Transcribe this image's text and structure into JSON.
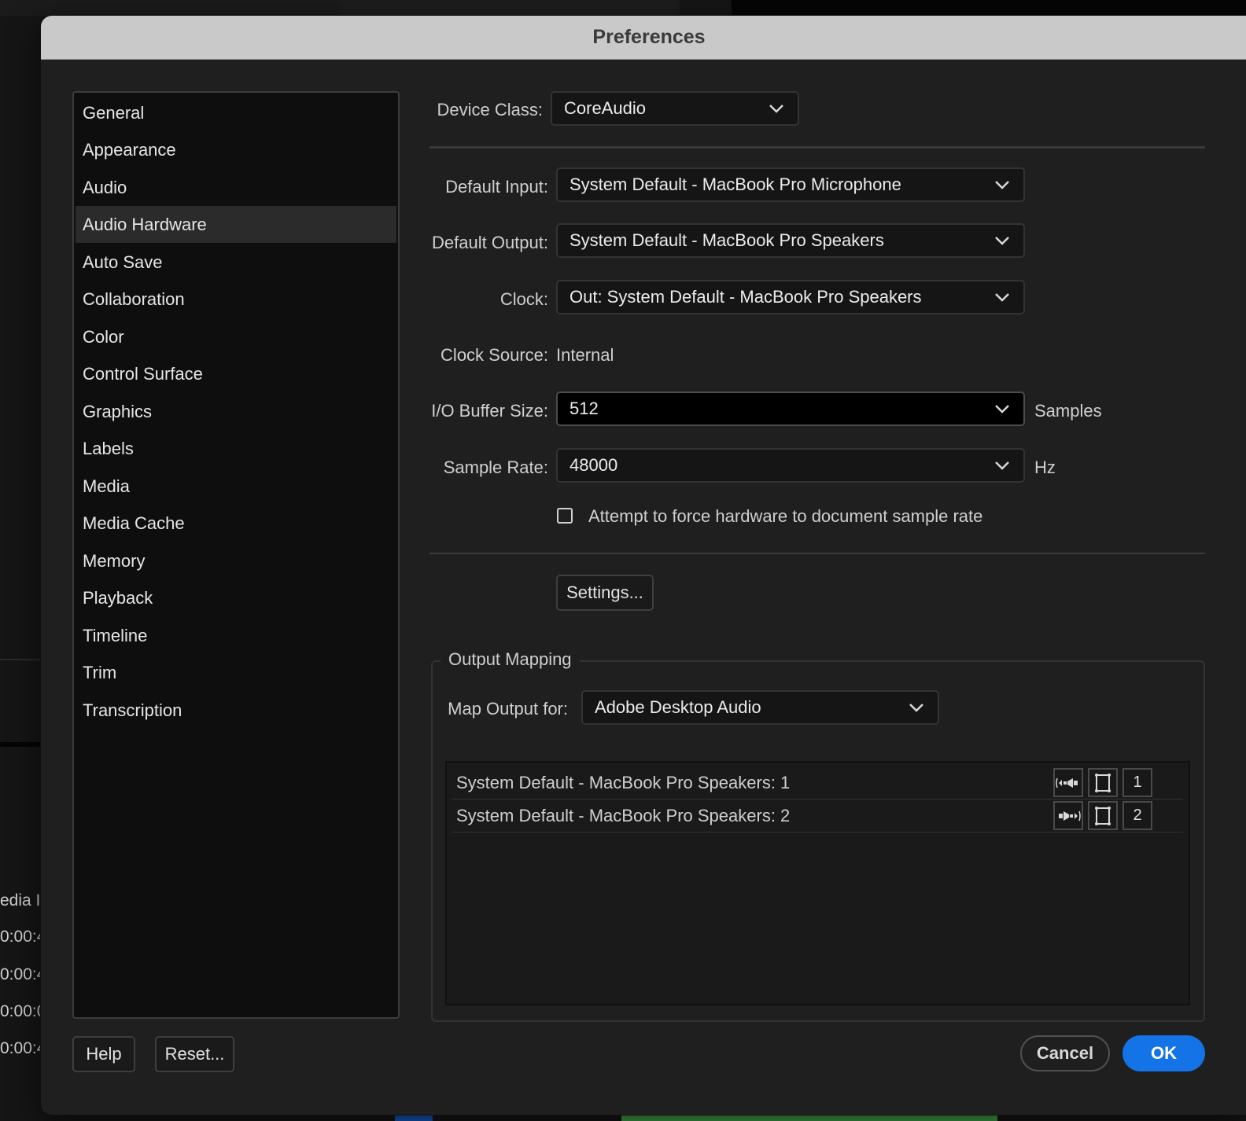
{
  "background": {
    "timecodes": [
      "edia I",
      "0:00:4",
      "0:00:4",
      "0:00:0",
      "0:00:4"
    ]
  },
  "dialog": {
    "title": "Preferences"
  },
  "nav": {
    "items": [
      {
        "label": "General"
      },
      {
        "label": "Appearance"
      },
      {
        "label": "Audio"
      },
      {
        "label": "Audio Hardware",
        "selected": true
      },
      {
        "label": "Auto Save"
      },
      {
        "label": "Collaboration"
      },
      {
        "label": "Color"
      },
      {
        "label": "Control Surface"
      },
      {
        "label": "Graphics"
      },
      {
        "label": "Labels"
      },
      {
        "label": "Media"
      },
      {
        "label": "Media Cache"
      },
      {
        "label": "Memory"
      },
      {
        "label": "Playback"
      },
      {
        "label": "Timeline"
      },
      {
        "label": "Trim"
      },
      {
        "label": "Transcription"
      }
    ]
  },
  "device_class": {
    "label": "Device Class:",
    "value": "CoreAudio"
  },
  "default_input": {
    "label": "Default Input:",
    "value": "System Default - MacBook Pro Microphone"
  },
  "default_output": {
    "label": "Default Output:",
    "value": "System Default - MacBook Pro Speakers"
  },
  "clock": {
    "label": "Clock:",
    "value": "Out: System Default - MacBook Pro Speakers"
  },
  "clock_source": {
    "label": "Clock Source:",
    "value": "Internal"
  },
  "buffer_size": {
    "label": "I/O Buffer Size:",
    "value": "512",
    "unit": "Samples"
  },
  "sample_rate": {
    "label": "Sample Rate:",
    "value": "48000",
    "unit": "Hz"
  },
  "force_rate": {
    "label": "Attempt to force hardware to document sample rate",
    "checked": false
  },
  "settings_button": "Settings...",
  "output_mapping": {
    "title": "Output Mapping",
    "map_label": "Map Output for:",
    "map_value": "Adobe Desktop Audio",
    "rows": [
      {
        "name": "System Default - MacBook Pro Speakers: 1",
        "channel": "1"
      },
      {
        "name": "System Default - MacBook Pro Speakers: 2",
        "channel": "2"
      }
    ]
  },
  "footer": {
    "help": "Help",
    "reset": "Reset...",
    "cancel": "Cancel",
    "ok": "OK"
  },
  "colors": {
    "accent": "#1473e6",
    "dialog_bg": "#1f1f1f",
    "titlebar_bg": "#c9c9c9"
  }
}
